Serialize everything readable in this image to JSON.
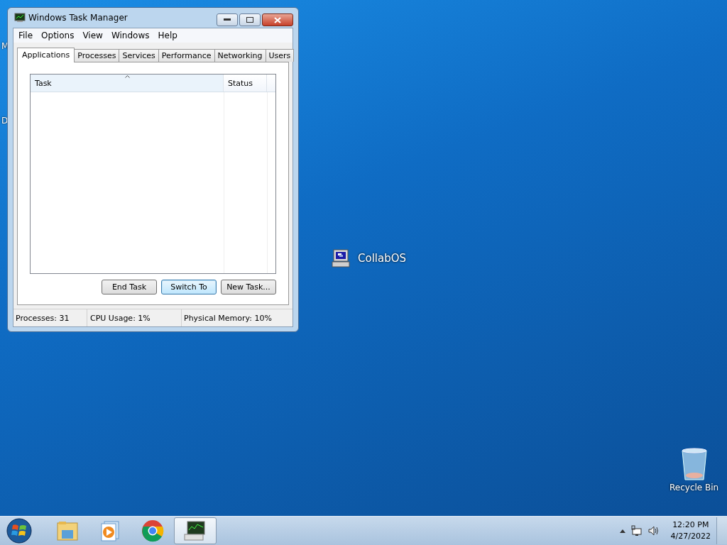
{
  "desktop": {
    "cut_labels": [
      "M",
      "D"
    ],
    "icons": [
      {
        "kind": "app",
        "label": "CollabOS"
      },
      {
        "kind": "recycle",
        "label": "Recycle Bin"
      }
    ]
  },
  "window": {
    "title": "Windows Task Manager",
    "menu": [
      "File",
      "Options",
      "View",
      "Windows",
      "Help"
    ],
    "tabs": [
      {
        "label": "Applications",
        "selected": true
      },
      {
        "label": "Processes",
        "selected": false
      },
      {
        "label": "Services",
        "selected": false
      },
      {
        "label": "Performance",
        "selected": false
      },
      {
        "label": "Networking",
        "selected": false
      },
      {
        "label": "Users",
        "selected": false
      }
    ],
    "table": {
      "columns": [
        "Task",
        "Status"
      ]
    },
    "buttons": [
      {
        "label": "End Task",
        "focused": false
      },
      {
        "label": "Switch To",
        "focused": true
      },
      {
        "label": "New Task...",
        "focused": false
      }
    ],
    "status_bar": [
      "Processes: 31",
      "CPU Usage: 1%",
      "Physical Memory: 10%"
    ]
  },
  "taskbar": {
    "items": [
      {
        "kind": "folder",
        "active": false
      },
      {
        "kind": "media",
        "active": false
      },
      {
        "kind": "browser",
        "active": false
      },
      {
        "kind": "monitor",
        "active": true
      }
    ],
    "clock": {
      "time": "12:20 PM",
      "date": "4/27/2022"
    }
  }
}
